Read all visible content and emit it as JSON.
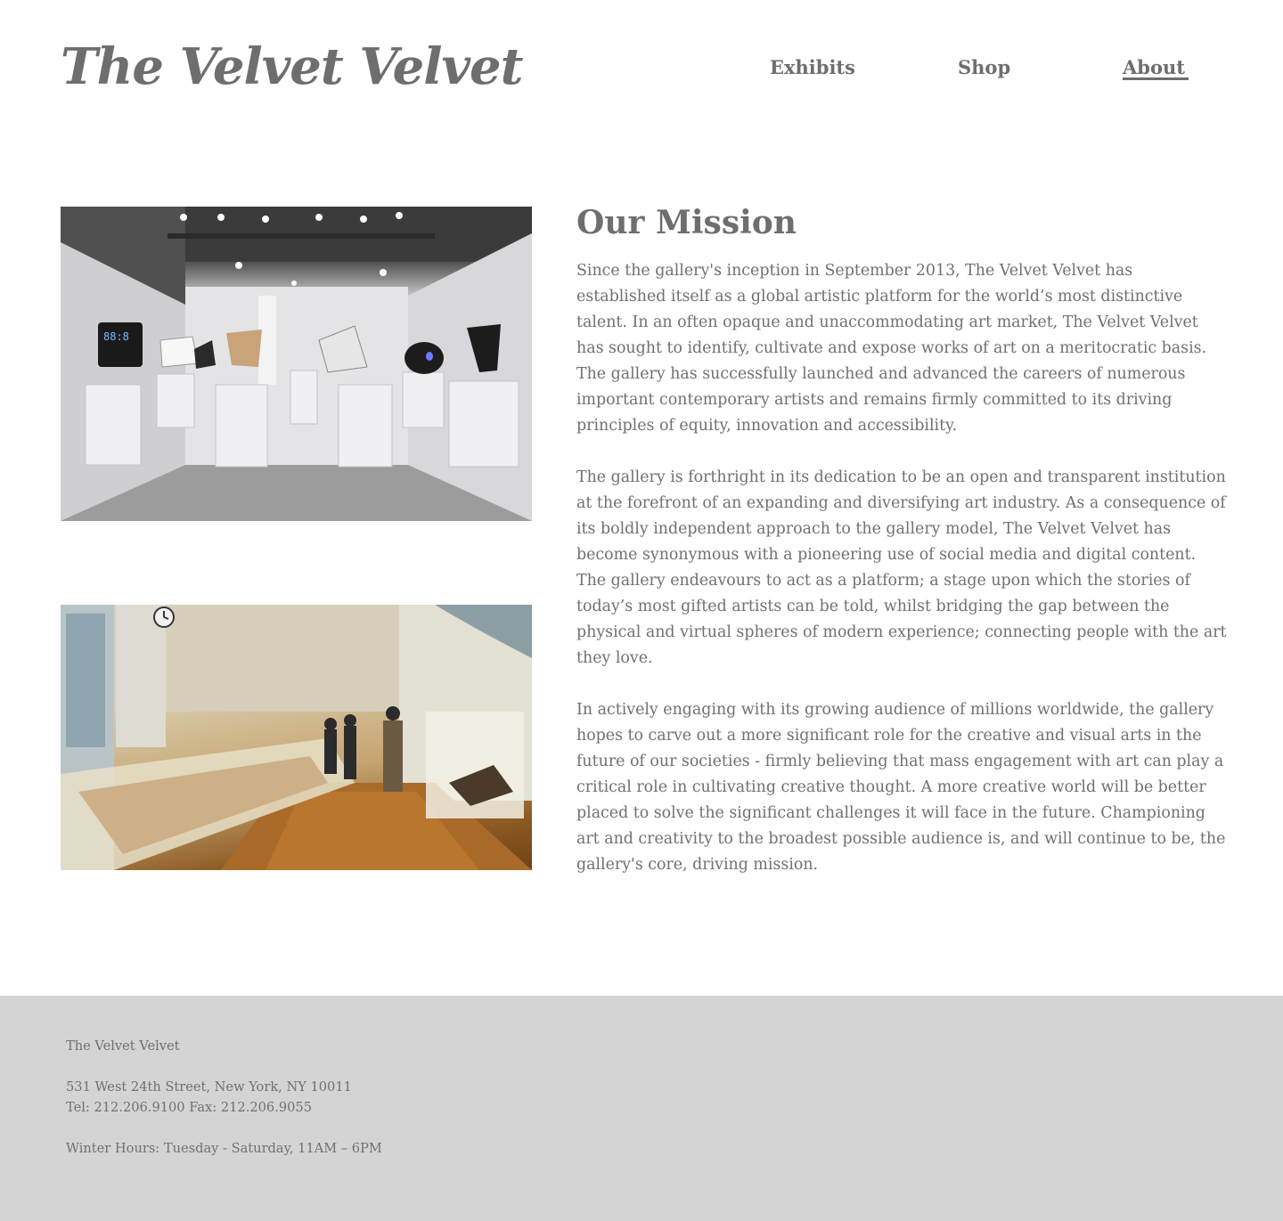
{
  "header": {
    "logo": "The Velvet Velvet",
    "nav": {
      "exhibits": "Exhibits",
      "shop": "Shop",
      "about": "About"
    },
    "active_nav": "About"
  },
  "main": {
    "title": "Our Mission",
    "paragraphs": [
      "Since the gallery's inception in September 2013, The Velvet Velvet has established itself as a global artistic platform for the world’s most distinctive talent. In an often opaque and unaccommodating art market, The Velvet Velvet has sought to identify, cultivate and expose works of art on a meritocratic basis. The gallery has successfully launched and advanced the careers of numerous important contemporary artists and remains firmly committed to its driving principles of equity, innovation and accessibility.",
      "The gallery is forthright in its dedication to be an open and transparent institution at the forefront of an expanding and diversifying art industry. As a consequence of its boldly independent approach to the gallery model, The Velvet Velvet has become synonymous with a pioneering use of social media and digital content. The gallery endeavours to act as a platform; a stage upon which the stories of today’s most gifted artists can be told, whilst bridging the gap between the physical and virtual spheres of modern experience; connecting people with the art they love.",
      "In actively engaging with its growing audience of millions worldwide, the gallery hopes to carve out a more significant role for the creative and visual arts in the future of our societies - firmly believing that mass engagement with art can play a critical role in cultivating creative thought. A more creative world will be better placed to solve the significant challenges it will face in the future. Championing art and creativity to the broadest possible audience is, and will continue to be, the gallery's core, driving mission."
    ]
  },
  "footer": {
    "name": "The Velvet Velvet",
    "address": "531 West 24th Street, New York, NY 10011",
    "tel": "Tel: 212.206.9100 Fax: 212.206.9055",
    "hours": "Winter Hours: Tuesday - Saturday, 11AM – 6PM"
  },
  "colors": {
    "text": "#6f6f6f",
    "footer_bg": "#d4d4d4",
    "background": "#ffffff"
  }
}
